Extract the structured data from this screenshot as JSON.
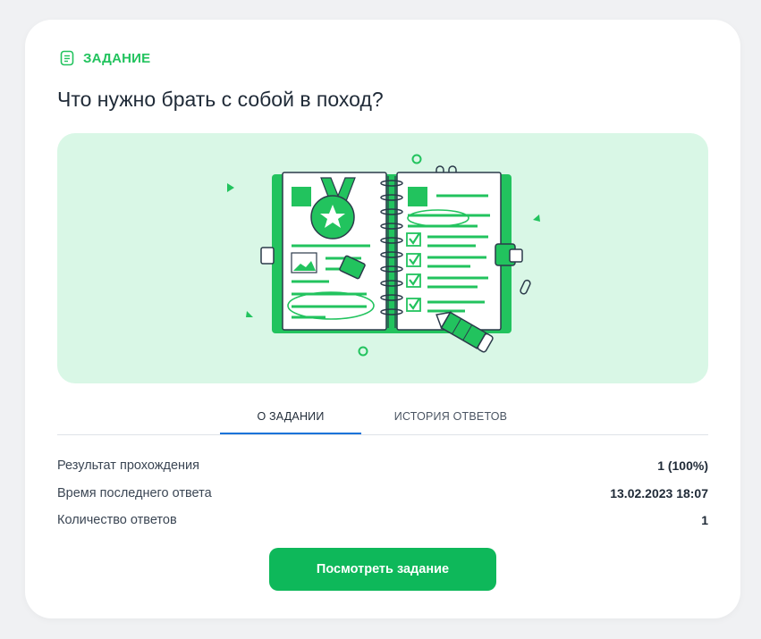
{
  "task": {
    "badge_label": "ЗАДАНИЕ",
    "title": "Что нужно брать с собой в поход?"
  },
  "illustration": {
    "icon": "notebook-illustration",
    "colors": {
      "accent": "#22c35e",
      "background": "#d9f7e6"
    }
  },
  "tabs": [
    {
      "label": "О ЗАДАНИИ",
      "active": true
    },
    {
      "label": "ИСТОРИЯ ОТВЕТОВ",
      "active": false
    }
  ],
  "stats": [
    {
      "label": "Результат прохождения",
      "value": "1 (100%)"
    },
    {
      "label": "Время последнего ответа",
      "value": "13.02.2023 18:07"
    },
    {
      "label": "Количество ответов",
      "value": "1"
    }
  ],
  "action_button": {
    "label": "Посмотреть задание"
  },
  "colors": {
    "brand_green": "#0eb85a",
    "active_tab_underline": "#1a73d9"
  }
}
